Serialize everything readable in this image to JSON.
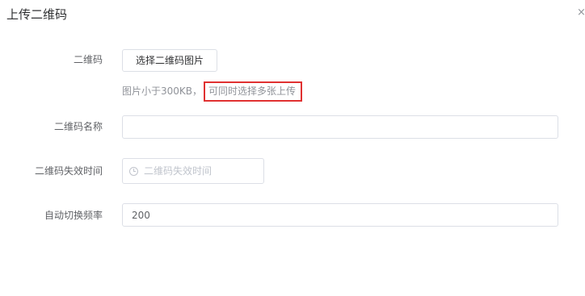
{
  "dialog": {
    "title": "上传二维码",
    "close_glyph": "×"
  },
  "form": {
    "qrcode": {
      "label": "二维码",
      "button_label": "选择二维码图片",
      "tip_prefix": "图片小于300KB，",
      "tip_highlight": "可同时选择多张上传"
    },
    "name": {
      "label": "二维码名称",
      "value": ""
    },
    "expire": {
      "label": "二维码失效时间",
      "placeholder": "二维码失效时间",
      "icon": "clock-icon"
    },
    "frequency": {
      "label": "自动切换频率",
      "value": "200"
    }
  },
  "colors": {
    "highlight_border": "#e03131",
    "input_border": "#dcdfe6"
  }
}
